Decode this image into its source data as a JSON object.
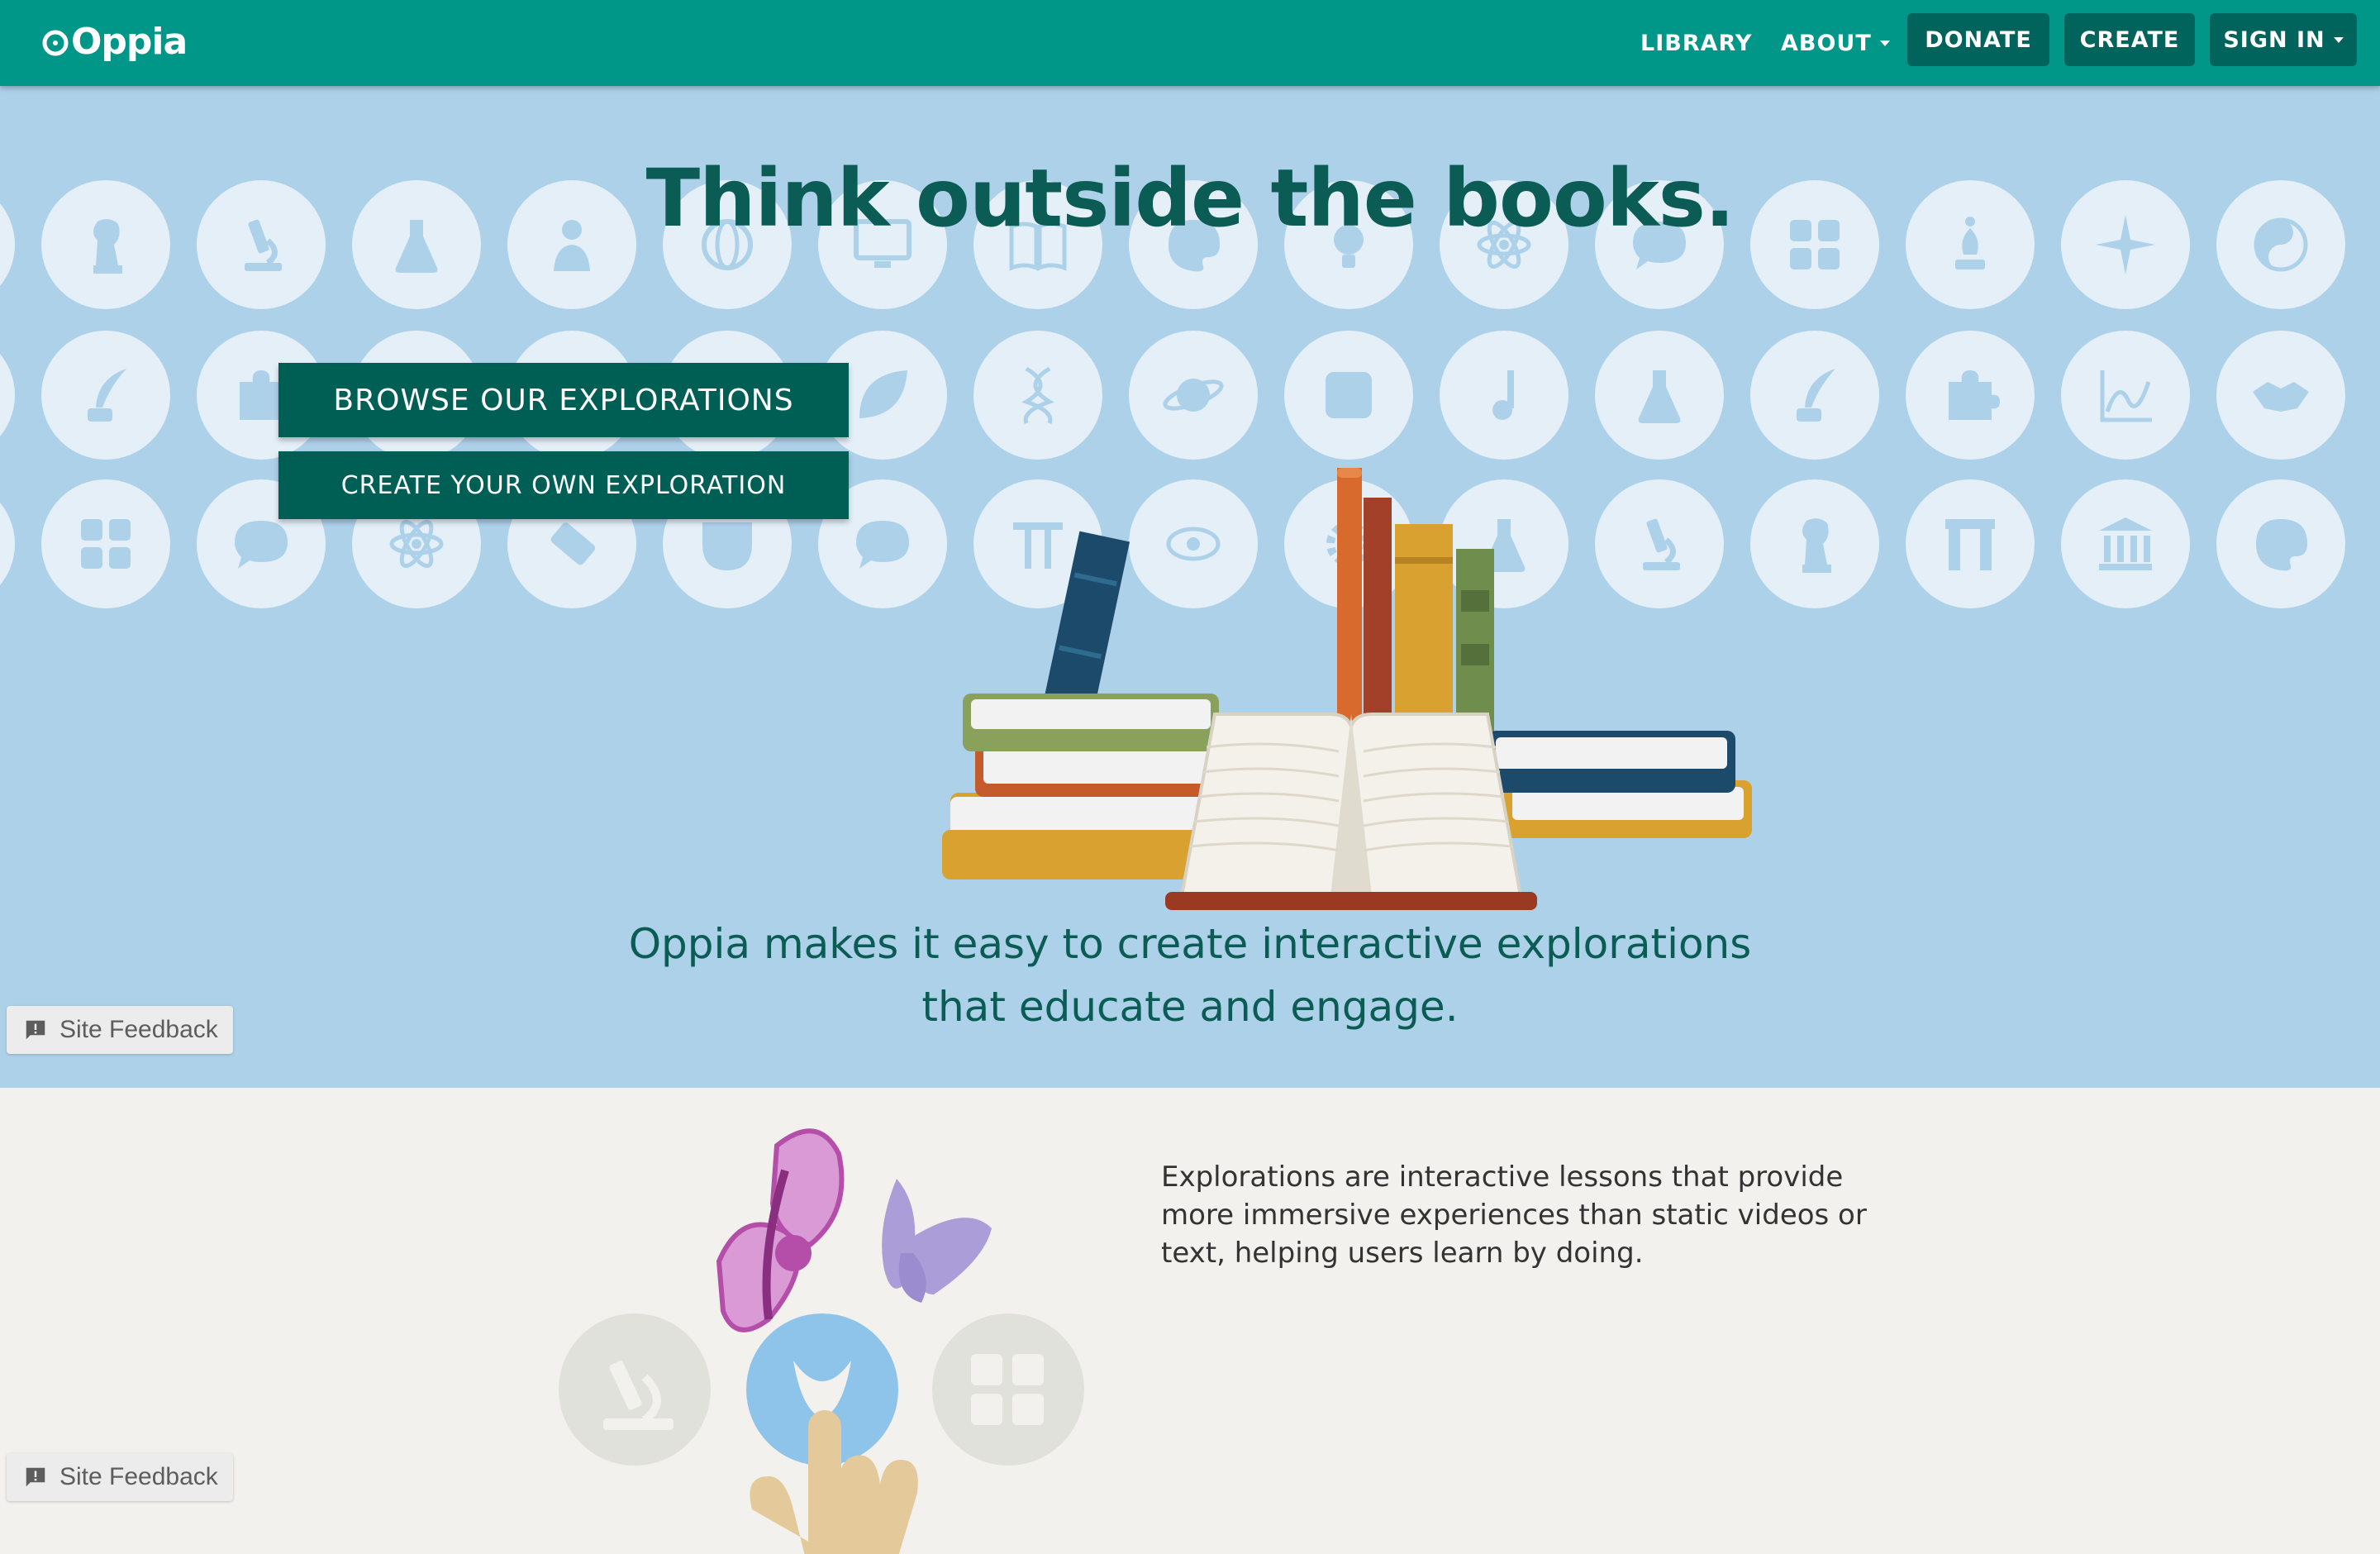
{
  "nav": {
    "logo": "Oppia",
    "library": "LIBRARY",
    "about": "ABOUT",
    "donate": "DONATE",
    "create": "CREATE",
    "sign_in": "SIGN IN"
  },
  "hero": {
    "headline": "Think outside the books.",
    "browse_button": "BROWSE OUR EXPLORATIONS",
    "create_button": "CREATE YOUR OWN EXPLORATION",
    "tagline_line1": "Oppia makes it easy to create interactive explorations",
    "tagline_line2": "that educate and engage."
  },
  "feedback": {
    "label": "Site Feedback"
  },
  "lower": {
    "description": "Explorations are interactive lessons that provide more immersive experiences than static videos or text, helping users learn by doing."
  },
  "colors": {
    "navbar": "#009688",
    "nav_button": "#00645c",
    "hero_bg": "#aed1ea",
    "icon_circle": "#e4eff8",
    "headline": "#0b5c55",
    "cta": "#005f54",
    "lower_bg": "#f2f1ed"
  },
  "icons": {
    "row1": [
      "knight-icon",
      "microscope-icon",
      "flask-icon",
      "person-icon",
      "globe-icon",
      "monitor-icon",
      "book-icon",
      "palette-icon",
      "lightbulb-icon",
      "atom-icon",
      "speech-bubble-icon",
      "calculator-icon",
      "chess-bishop-icon",
      "compass-star-icon",
      "yin-yang-icon"
    ],
    "row2": [
      "quill-icon",
      "puzzle-icon",
      "graph-icon",
      "handshake-icon",
      "compass-icon",
      "leaf-icon",
      "dna-icon",
      "planet-icon",
      "dice-icon",
      "music-note-icon",
      "flask-icon",
      "quill-icon",
      "puzzle-icon",
      "graph-icon",
      "handshake-icon"
    ],
    "row3": [
      "calculator-icon",
      "speech-bubble-icon",
      "atom-icon",
      "domino-icon",
      "theater-mask-icon",
      "question-bubble-icon",
      "pi-icon",
      "eye-icon",
      "gear-icon",
      "chemistry-icon",
      "microscope-icon",
      "knight-icon",
      "arch-icon",
      "museum-icon",
      "palette-icon"
    ]
  }
}
